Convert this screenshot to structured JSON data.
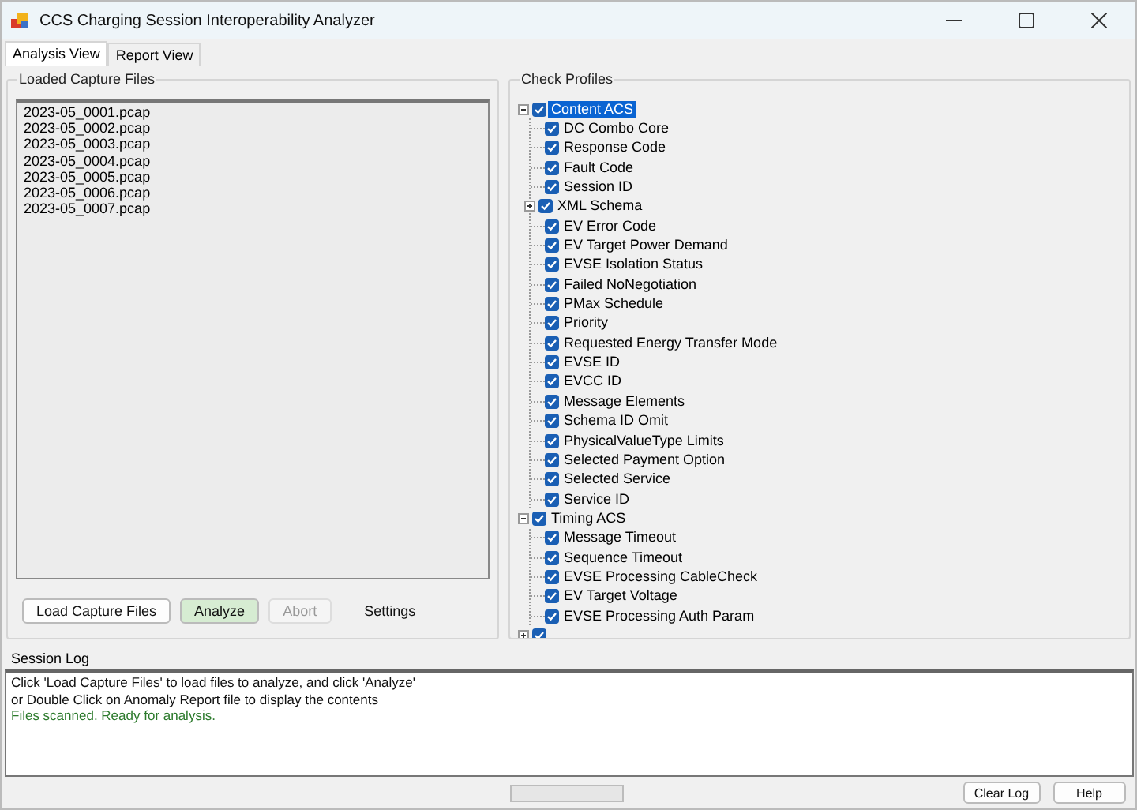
{
  "window": {
    "title": "CCS Charging Session Interoperability Analyzer"
  },
  "tabs": [
    {
      "label": "Analysis View",
      "selected": true
    },
    {
      "label": "Report View",
      "selected": false
    }
  ],
  "capture_files": {
    "title": "Loaded Capture Files",
    "files": [
      "2023-05_0001.pcap",
      "2023-05_0002.pcap",
      "2023-05_0003.pcap",
      "2023-05_0004.pcap",
      "2023-05_0005.pcap",
      "2023-05_0006.pcap",
      "2023-05_0007.pcap"
    ]
  },
  "actions": [
    {
      "label": "Load Capture Files",
      "kind": "push",
      "active": false,
      "disabled": false
    },
    {
      "label": "Analyze",
      "kind": "push",
      "active": true,
      "disabled": false
    },
    {
      "label": "Abort",
      "kind": "push",
      "active": false,
      "disabled": true
    },
    {
      "label": "Settings",
      "kind": "flat",
      "disabled": false
    }
  ],
  "check_profiles": {
    "title": "Check Profiles",
    "tree": [
      {
        "label": "Content ACS",
        "checked": true,
        "selected": true,
        "expanded": true,
        "children": [
          {
            "label": "DC Combo Core",
            "checked": true,
            "selected": false
          },
          {
            "label": "Response Code",
            "checked": true,
            "selected": false
          },
          {
            "label": "Fault Code",
            "checked": true,
            "selected": false
          },
          {
            "label": "Session ID",
            "checked": true,
            "selected": false
          },
          {
            "label": "XML Schema",
            "checked": true,
            "selected": false,
            "expanded": false
          },
          {
            "label": "EV Error Code",
            "checked": true,
            "selected": false
          },
          {
            "label": "EV Target Power Demand",
            "checked": true,
            "selected": false
          },
          {
            "label": "EVSE Isolation Status",
            "checked": true,
            "selected": false
          },
          {
            "label": "Failed NoNegotiation",
            "checked": true,
            "selected": false
          },
          {
            "label": "PMax Schedule",
            "checked": true,
            "selected": false
          },
          {
            "label": "Priority",
            "checked": true,
            "selected": false
          },
          {
            "label": "Requested Energy Transfer Mode",
            "checked": true,
            "selected": false
          },
          {
            "label": "EVSE ID",
            "checked": true,
            "selected": false
          },
          {
            "label": "EVCC ID",
            "checked": true,
            "selected": false
          },
          {
            "label": "Message Elements",
            "checked": true,
            "selected": false
          },
          {
            "label": "Schema ID Omit",
            "checked": true,
            "selected": false
          },
          {
            "label": "PhysicalValueType Limits",
            "checked": true,
            "selected": false
          },
          {
            "label": "Selected Payment Option",
            "checked": true,
            "selected": false
          },
          {
            "label": "Selected Service",
            "checked": true,
            "selected": false
          },
          {
            "label": "Service ID",
            "checked": true,
            "selected": false
          }
        ]
      },
      {
        "label": "Timing ACS",
        "checked": true,
        "selected": false,
        "expanded": true,
        "children": [
          {
            "label": "Message Timeout",
            "checked": true,
            "selected": false
          },
          {
            "label": "Sequence Timeout",
            "checked": true,
            "selected": false
          },
          {
            "label": "EVSE Processing CableCheck",
            "checked": true,
            "selected": false
          },
          {
            "label": "EV Target Voltage",
            "checked": true,
            "selected": false
          },
          {
            "label": "EVSE Processing Auth Param",
            "checked": true,
            "selected": false
          }
        ]
      },
      {
        "checked": true,
        "expanded": false
      }
    ]
  },
  "session_log": {
    "title": "Session Log",
    "lines": [
      {
        "text": "Click 'Load Capture Files' to load files to analyze, and click 'Analyze'",
        "kind": "info"
      },
      {
        "text": "or Double Click on Anomaly Report file to display the contents",
        "kind": "info"
      },
      {
        "text": "Files scanned. Ready for analysis.",
        "kind": "success"
      }
    ]
  },
  "progress": {
    "level": 0
  },
  "footer_buttons": [
    "Clear Log",
    "Help"
  ]
}
